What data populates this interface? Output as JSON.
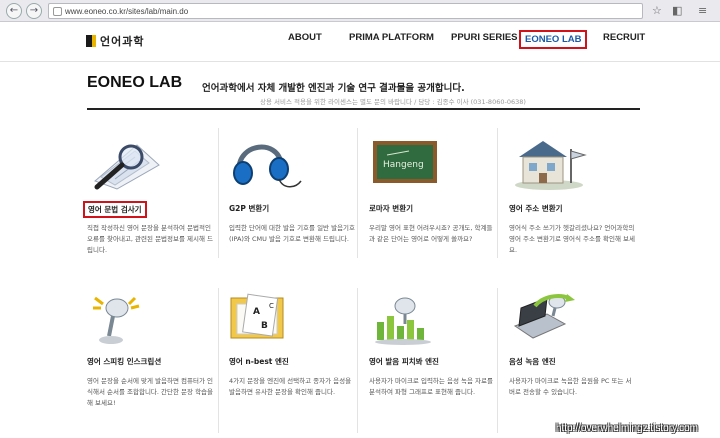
{
  "browser": {
    "url": "www.eoneo.co.kr/sites/lab/main.do",
    "back_glyph": "←",
    "forward_glyph": "→",
    "back_icon": "back-arrow-icon",
    "forward_icon": "forward-arrow-icon"
  },
  "header": {
    "logo_text": "언어과학",
    "nav": [
      {
        "label": "ABOUT"
      },
      {
        "label": "PRIMA PLATFORM"
      },
      {
        "label": "PPURI SERIES"
      },
      {
        "label": "EONEO LAB"
      },
      {
        "label": "RECRUIT"
      }
    ],
    "active_color": "#d0121b"
  },
  "lab": {
    "title": "EONEO LAB",
    "description": "언어과학에서 자체 개발한 엔진과 기술 연구 결과물을 공개합니다.",
    "contact": "상용 서비스 적용을 위한 라이센스는 별도 문의 바랍니다 / 담당 : 김종수 이사 (031-8060-0638)"
  },
  "cards": [
    {
      "title": "영어 문법 검사기",
      "desc": "직접 작성하신 영어 문장을 분석하여 문법적인 오류를 찾아내고, 관련된 문법정보를 제시해 드립니다.",
      "icon": "magnifier-document-icon"
    },
    {
      "title": "G2P 변환기",
      "desc": "입력한 단어에 대한 발음 기호를 일반 발음기호(IPA)와 CMU 발음 기호로 변환해 드립니다.",
      "icon": "headphones-icon"
    },
    {
      "title": "로마자 변환기",
      "desc": "우리말 영어 표현 어려우시죠? 공개도, 학계들과 같은 단어는 영어로 어떻게 쓸까요?",
      "icon": "chalkboard-icon",
      "board_text": "Hangeng"
    },
    {
      "title": "영어 주소 변환기",
      "desc": "영어식 주소 쓰기가 헷갈리셨나요? 언어과학의 영어 주소 변환기로 영어식 주소를 확인해 보세요.",
      "icon": "house-icon"
    },
    {
      "title": "영어 스피킹 인스크립션",
      "desc": "영어 문장을 순서에 맞게 발음하면 컴퓨터가 인식해서 순서를 조합합니다. 간단한 문장 학습을 해 보세요!",
      "icon": "microphone-icon"
    },
    {
      "title": "영어 n-best 엔진",
      "desc": "4가지 문장을 엔진에 선택하고 종자가 음성을 발음하면 유사한 문장을 확인해 줍니다.",
      "icon": "notebook-abc-icon"
    },
    {
      "title": "영어 발음 피치봐 엔진",
      "desc": "사용자가 마이크로 입력하는 음성 녹음 자료를 분석하여 파형 그래프로 표현해 줍니다.",
      "icon": "mic-bar-chart-icon"
    },
    {
      "title": "음성 녹음 엔진",
      "desc": "사용자가 마이크로 녹음한 음원을 PC 또는 서버로 전송할 수 있습니다.",
      "icon": "laptop-mic-icon"
    }
  ],
  "watermark": "http://overwhelmingz.tistory.com"
}
